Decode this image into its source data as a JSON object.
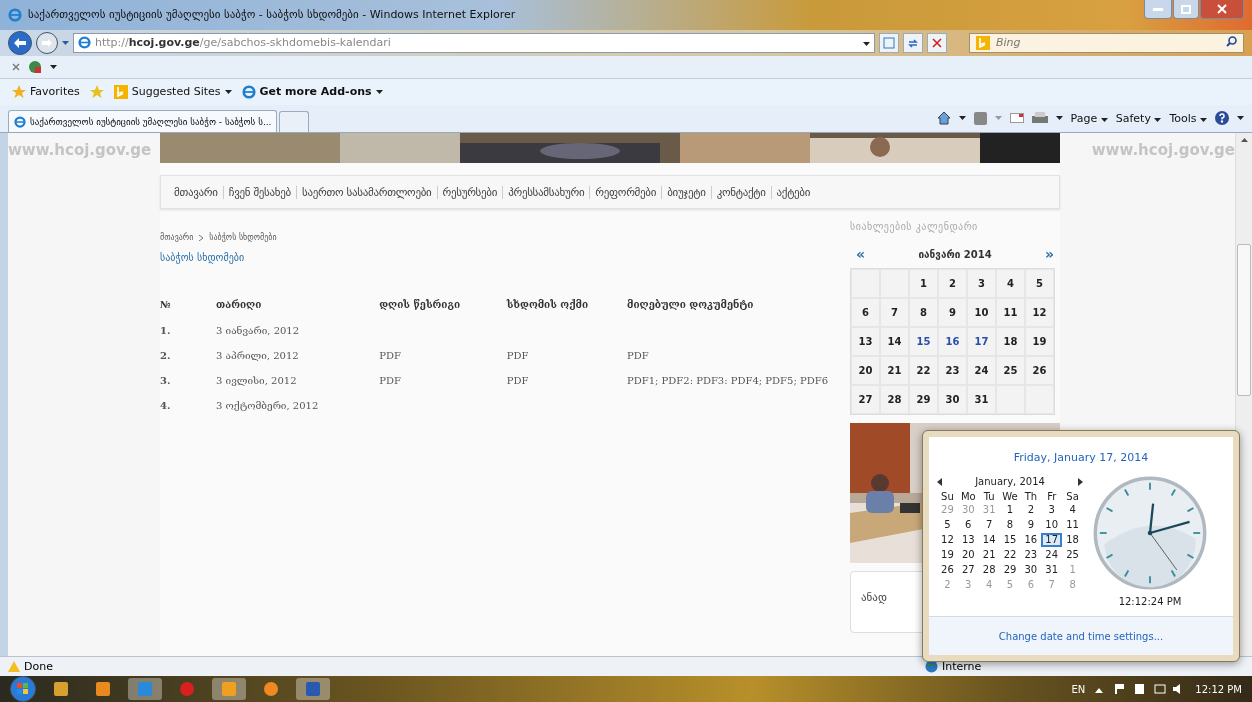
{
  "window": {
    "title": "საქართველოს იუსტიციის უმაღლესი საბჭო - საბჭოს სხდომები - Windows Internet Explorer"
  },
  "address_bar": {
    "url": "http://**hcoj.gov.ge**/ge/sabchos-skhdomebis-kalendari"
  },
  "search": {
    "placeholder": "Bing"
  },
  "favorites_bar": [
    {
      "kind": "favorites",
      "label": "Favorites"
    },
    {
      "kind": "menu",
      "label": "Suggested Sites"
    },
    {
      "kind": "addons",
      "label": "Get more Add-ons"
    }
  ],
  "tabs": [
    {
      "label": "საქართველოს იუსტიციის უმაღლესი საბჭო - საბჭოს ს...",
      "selected": true
    }
  ],
  "command_bar": [
    "Page",
    "Safety",
    "Tools"
  ],
  "background_text": [
    "www.hcoj.gov.ge",
    "www.hcoj.gov.ge"
  ],
  "nav": [
    "მთავარი",
    "ჩვენ შესახებ",
    "საერთო სასამართლოები",
    "რესურსები",
    "პრესსამსახური",
    "რეფორმები",
    "ბიუჯეტი",
    "კონტაქტი",
    "აქტები"
  ],
  "breadcrumb": [
    "მთავარი",
    "საბჭოს სხდომები"
  ],
  "heading": "საბჭოს სხდომები",
  "table": {
    "columns": [
      "№",
      "თარიღი",
      "დღის წესრიგი",
      "სხდომის ოქმი",
      "მიღებული დოკუმენტი"
    ],
    "rows": [
      [
        "1.",
        "3 იანვარი, 2012",
        "",
        "",
        ""
      ],
      [
        "2.",
        "3 აპრილი, 2012",
        "PDF",
        "PDF",
        "PDF"
      ],
      [
        "3.",
        "3 ივლისი, 2012",
        "PDF",
        "PDF",
        "PDF1; PDF2: PDF3: PDF4; PDF5; PDF6"
      ],
      [
        "4.",
        "3 ოქტომბერი, 2012",
        "",
        "",
        ""
      ]
    ]
  },
  "sidebar": {
    "title": "სიახლეების კალენდარი",
    "prev": "«",
    "next": "»",
    "month": "იანვარი 2014",
    "weeks": [
      [
        {
          "day": "1",
          "highlight": false
        },
        {
          "day": "2",
          "highlight": false
        },
        {
          "day": "3",
          "highlight": false
        },
        {
          "day": "4",
          "highlight": false
        },
        {
          "day": "5",
          "highlight": false
        }
      ],
      [
        {
          "day": "6",
          "highlight": false
        },
        {
          "day": "7",
          "highlight": false
        },
        {
          "day": "8",
          "highlight": false
        },
        {
          "day": "9",
          "highlight": false
        },
        {
          "day": "10",
          "highlight": false
        },
        {
          "day": "11",
          "highlight": false
        },
        {
          "day": "12",
          "highlight": false
        }
      ],
      [
        {
          "day": "13",
          "highlight": false
        },
        {
          "day": "14",
          "highlight": false
        },
        {
          "day": "15",
          "highlight": true
        },
        {
          "day": "16",
          "highlight": true
        },
        {
          "day": "17",
          "highlight": true
        },
        {
          "day": "18",
          "highlight": false
        },
        {
          "day": "19",
          "highlight": false
        }
      ],
      [
        {
          "day": "20",
          "highlight": false
        },
        {
          "day": "21",
          "highlight": false
        },
        {
          "day": "22",
          "highlight": false
        },
        {
          "day": "23",
          "highlight": false
        },
        {
          "day": "24",
          "highlight": false
        },
        {
          "day": "25",
          "highlight": false
        },
        {
          "day": "26",
          "highlight": false
        }
      ],
      [
        {
          "day": "27",
          "highlight": false
        },
        {
          "day": "28",
          "highlight": false
        },
        {
          "day": "29",
          "highlight": false
        },
        {
          "day": "30",
          "highlight": false
        },
        {
          "day": "31",
          "highlight": false
        }
      ]
    ],
    "box_title": "ანად"
  },
  "date_popup": {
    "heading": "Friday, January 17, 2014",
    "month": "January, 2014",
    "weekdays": [
      "Su",
      "Mo",
      "Tu",
      "We",
      "Th",
      "Fr",
      "Sa"
    ],
    "days": [
      {
        "day": "29",
        "muted": true,
        "selected": false
      },
      {
        "day": "30",
        "muted": true,
        "selected": false
      },
      {
        "day": "31",
        "muted": true,
        "selected": false
      },
      {
        "day": "1",
        "muted": false,
        "selected": false
      },
      {
        "day": "2",
        "muted": false,
        "selected": false
      },
      {
        "day": "3",
        "muted": false,
        "selected": false
      },
      {
        "day": "4",
        "muted": false,
        "selected": false
      },
      {
        "day": "5",
        "muted": false,
        "selected": false
      },
      {
        "day": "6",
        "muted": false,
        "selected": false
      },
      {
        "day": "7",
        "muted": false,
        "selected": false
      },
      {
        "day": "8",
        "muted": false,
        "selected": false
      },
      {
        "day": "9",
        "muted": false,
        "selected": false
      },
      {
        "day": "10",
        "muted": false,
        "selected": false
      },
      {
        "day": "11",
        "muted": false,
        "selected": false
      },
      {
        "day": "12",
        "muted": false,
        "selected": false
      },
      {
        "day": "13",
        "muted": false,
        "selected": false
      },
      {
        "day": "14",
        "muted": false,
        "selected": false
      },
      {
        "day": "15",
        "muted": false,
        "selected": false
      },
      {
        "day": "16",
        "muted": false,
        "selected": false
      },
      {
        "day": "17",
        "muted": false,
        "selected": true
      },
      {
        "day": "18",
        "muted": false,
        "selected": false
      },
      {
        "day": "19",
        "muted": false,
        "selected": false
      },
      {
        "day": "20",
        "muted": false,
        "selected": false
      },
      {
        "day": "21",
        "muted": false,
        "selected": false
      },
      {
        "day": "22",
        "muted": false,
        "selected": false
      },
      {
        "day": "23",
        "muted": false,
        "selected": false
      },
      {
        "day": "24",
        "muted": false,
        "selected": false
      },
      {
        "day": "25",
        "muted": false,
        "selected": false
      },
      {
        "day": "26",
        "muted": false,
        "selected": false
      },
      {
        "day": "27",
        "muted": false,
        "selected": false
      },
      {
        "day": "28",
        "muted": false,
        "selected": false
      },
      {
        "day": "29",
        "muted": false,
        "selected": false
      },
      {
        "day": "30",
        "muted": false,
        "selected": false
      },
      {
        "day": "31",
        "muted": false,
        "selected": false
      },
      {
        "day": "1",
        "muted": true,
        "selected": false
      },
      {
        "day": "2",
        "muted": true,
        "selected": false
      },
      {
        "day": "3",
        "muted": true,
        "selected": false
      },
      {
        "day": "4",
        "muted": true,
        "selected": false
      },
      {
        "day": "5",
        "muted": true,
        "selected": false
      },
      {
        "day": "6",
        "muted": true,
        "selected": false
      },
      {
        "day": "7",
        "muted": true,
        "selected": false
      },
      {
        "day": "8",
        "muted": true,
        "selected": false
      }
    ],
    "time": "12:12:24 PM",
    "link": "Change date and time settings..."
  },
  "status_bar": {
    "text": "Done",
    "zone": "Interne"
  },
  "taskbar": {
    "language": "EN",
    "clock": "12:12 PM"
  }
}
